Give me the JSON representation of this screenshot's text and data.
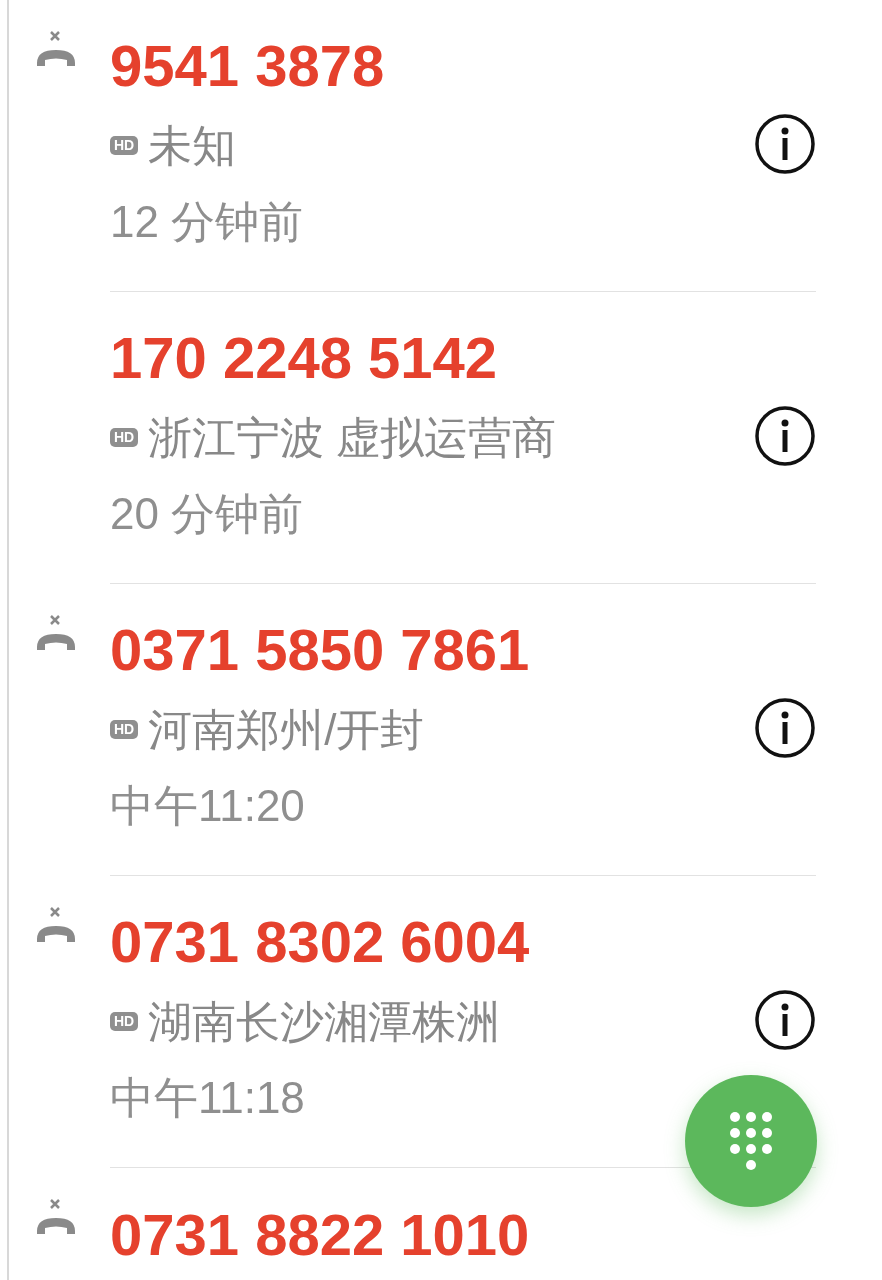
{
  "calls": [
    {
      "number": "9541 3878",
      "missed": true,
      "hd_badge": "HD",
      "location": "未知",
      "time": "12 分钟前"
    },
    {
      "number": "170 2248 5142",
      "missed": false,
      "hd_badge": "HD",
      "location": "浙江宁波 虚拟运营商",
      "time": "20 分钟前"
    },
    {
      "number": "0371 5850 7861",
      "missed": true,
      "hd_badge": "HD",
      "location": "河南郑州/开封",
      "time": "中午11:20"
    },
    {
      "number": "0731 8302 6004",
      "missed": true,
      "hd_badge": "HD",
      "location": "湖南长沙湘潭株洲",
      "time": "中午11:18"
    },
    {
      "number": "0731 8822 1010",
      "missed": true
    }
  ]
}
